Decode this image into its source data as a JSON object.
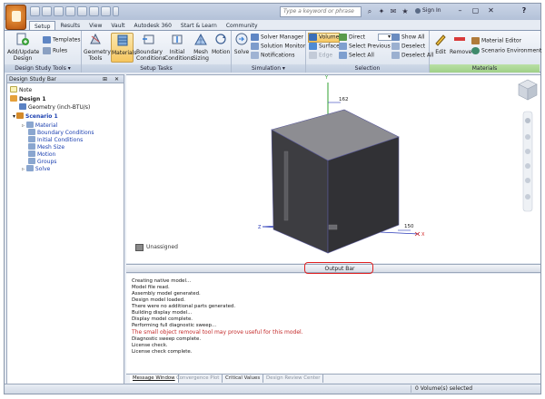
{
  "titlebar": {
    "search_placeholder": "Type a keyword or phrase",
    "sign_in": "Sign In",
    "help": "?"
  },
  "tabs": [
    "Setup",
    "Results",
    "View",
    "Vault",
    "Autodesk 360",
    "Start & Learn",
    "Community"
  ],
  "ribbon": {
    "add_update_design": "Add/Update\nDesign",
    "templates": "Templates",
    "rules": "Rules",
    "geometry_tools": "Geometry\nTools",
    "materials": "Materials",
    "boundary_conditions": "Boundary\nConditions",
    "initial_conditions": "Initial\nConditions",
    "mesh_sizing": "Mesh\nSizing",
    "motion": "Motion",
    "solve": "Solve",
    "solver_manager": "Solver Manager",
    "solution_monitor": "Solution Monitor",
    "notifications": "Notifications",
    "volume": "Volume",
    "surface": "Surface",
    "edge": "Edge",
    "direct": "Direct",
    "select_previous": "Select Previous",
    "select_all": "Select All",
    "show_all": "Show All",
    "deselect": "Deselect",
    "deselect_all": "Deselect All",
    "edit": "Edit",
    "remove": "Remove",
    "material_editor": "Material Editor",
    "scenario_environment": "Scenario Environment",
    "panels": {
      "design_study_tools": "Design Study Tools ▾",
      "setup_tasks": "Setup Tasks",
      "simulation": "Simulation ▾",
      "selection": "Selection",
      "materials": "Materials"
    }
  },
  "design_study_bar": {
    "title": "Design Study Bar",
    "pins": "⊞ ✕",
    "tree": {
      "note": "Note",
      "design": "Design 1",
      "geometry": "Geometry (inch-BTU/s)",
      "scenario": "Scenario 1",
      "items": [
        "Material",
        "Boundary Conditions",
        "Initial Conditions",
        "Mesh Size",
        "Motion",
        "Groups",
        "Solve"
      ]
    }
  },
  "viewport": {
    "axis_label_top": "162",
    "axis_label_right": "150",
    "legend_label": "Unassigned",
    "axis_y": "Y",
    "axis_x": "X",
    "axis_z": "Z"
  },
  "output_bar": {
    "label": "Output Bar"
  },
  "messages": [
    "Creating native model...",
    "Model file read.",
    "Assembly model generated.",
    "Design model loaded.",
    "There were no additional parts generated.",
    "Building display model...",
    "Display model complete.",
    "Performing full diagnostic sweep...",
    "The small object removal tool may prove useful for this model.",
    "Diagnostic sweep complete.",
    "License check.",
    "License check complete."
  ],
  "bottom_tabs": [
    "Message Window",
    "Convergence Plot",
    "Critical Values",
    "Design Review Center"
  ],
  "status": {
    "selection": "0 Volume(s) selected"
  },
  "colors": {
    "accent_red": "#e02020",
    "warning_text": "#c42b2b",
    "link_blue": "#1a3fb0",
    "box_face": "#3b3b3f",
    "box_top": "#8d8d92"
  }
}
